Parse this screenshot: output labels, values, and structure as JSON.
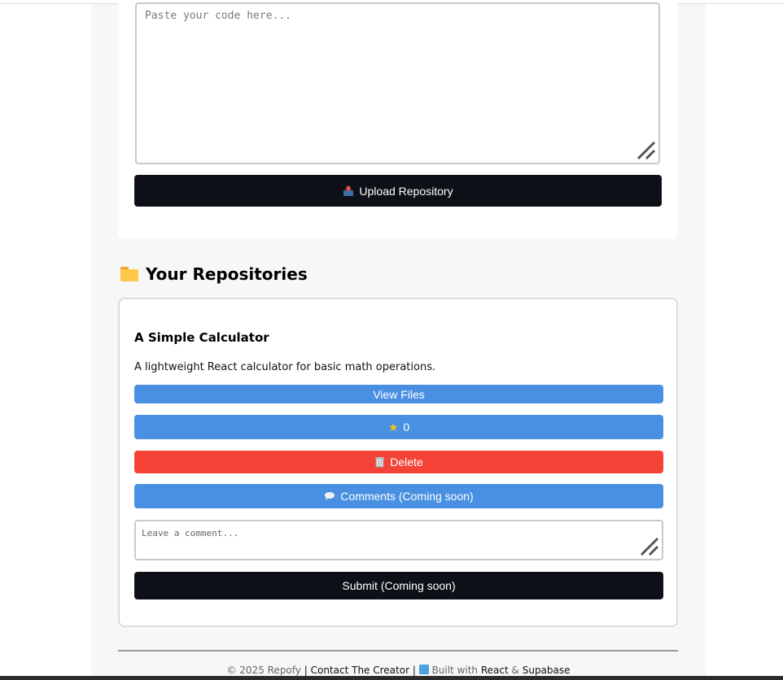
{
  "upload": {
    "code_placeholder": "Paste your code here...",
    "upload_button_label": "Upload Repository",
    "upload_icon": "outbox-tray-icon"
  },
  "repositories": {
    "section_title": "Your Repositories",
    "section_icon": "folder-icon",
    "items": [
      {
        "title": "A Simple Calculator",
        "description": "A lightweight React calculator for basic math operations.",
        "view_files_label": "View Files",
        "star_count": "0",
        "delete_label": "Delete",
        "comments_label": "Comments (Coming soon)",
        "comment_placeholder": "Leave a comment...",
        "submit_label": "Submit (Coming soon)"
      }
    ]
  },
  "footer": {
    "copyright": "© 2025 Repofy",
    "separator": "|",
    "contact_link": "Contact The Creator",
    "built_with": "Built with",
    "react_link": "React",
    "ampersand": "&",
    "supabase_link": "Supabase"
  },
  "colors": {
    "primary_blue": "#4a90e2",
    "danger_red": "#f44336",
    "dark_button": "#0d1117"
  }
}
